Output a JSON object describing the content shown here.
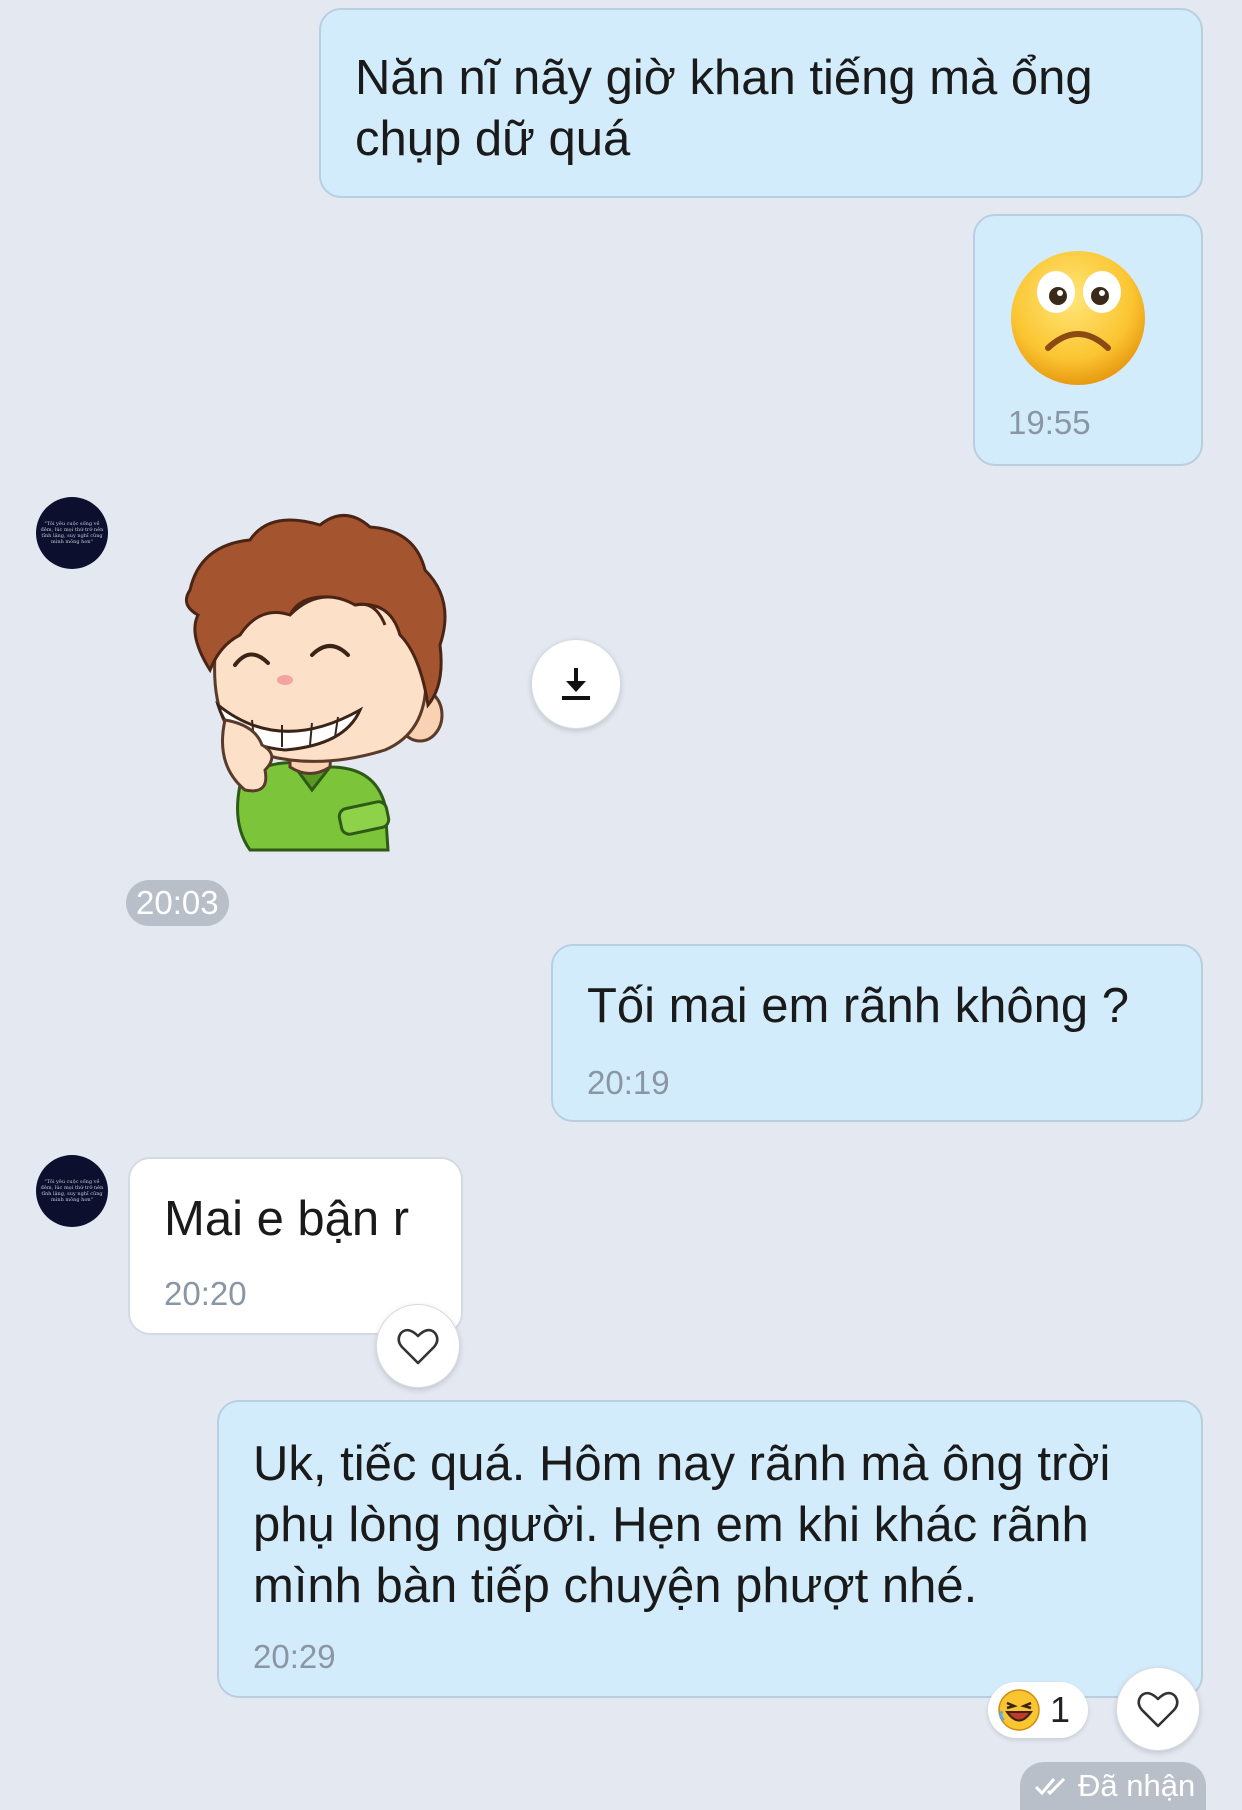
{
  "messages": {
    "m1": {
      "text": "Năn nĩ nãy giờ khan tiếng mà ổng chụp dữ quá"
    },
    "m2": {
      "emoji": "sad-face-emoji",
      "time": "19:55"
    },
    "m3": {
      "sticker": "grinning-boy-sticker",
      "time": "20:03"
    },
    "m4": {
      "text": "Tối mai em rãnh không ?",
      "time": "20:19"
    },
    "m5": {
      "text": "Mai e bận r",
      "time": "20:20"
    },
    "m6": {
      "text": "Uk, tiếc quá. Hôm nay rãnh mà ông trời phụ lòng người. Hẹn em khi khác rãnh mình bàn tiếp chuyện phượt nhé.",
      "time": "20:29"
    }
  },
  "reactions": {
    "laugh_count": "1"
  },
  "status": {
    "received": "Đã nhận"
  },
  "avatar": {
    "caption": "\"Tôi yêu cuộc sống về đêm, lúc mọi thứ trở nên tĩnh lặng, suy nghĩ cũng mình mông hơn\""
  },
  "colors": {
    "background": "#e3e8f1",
    "my_bubble": "#d3ecfb",
    "their_bubble": "#ffffff",
    "timestamp": "#8a96a6"
  }
}
